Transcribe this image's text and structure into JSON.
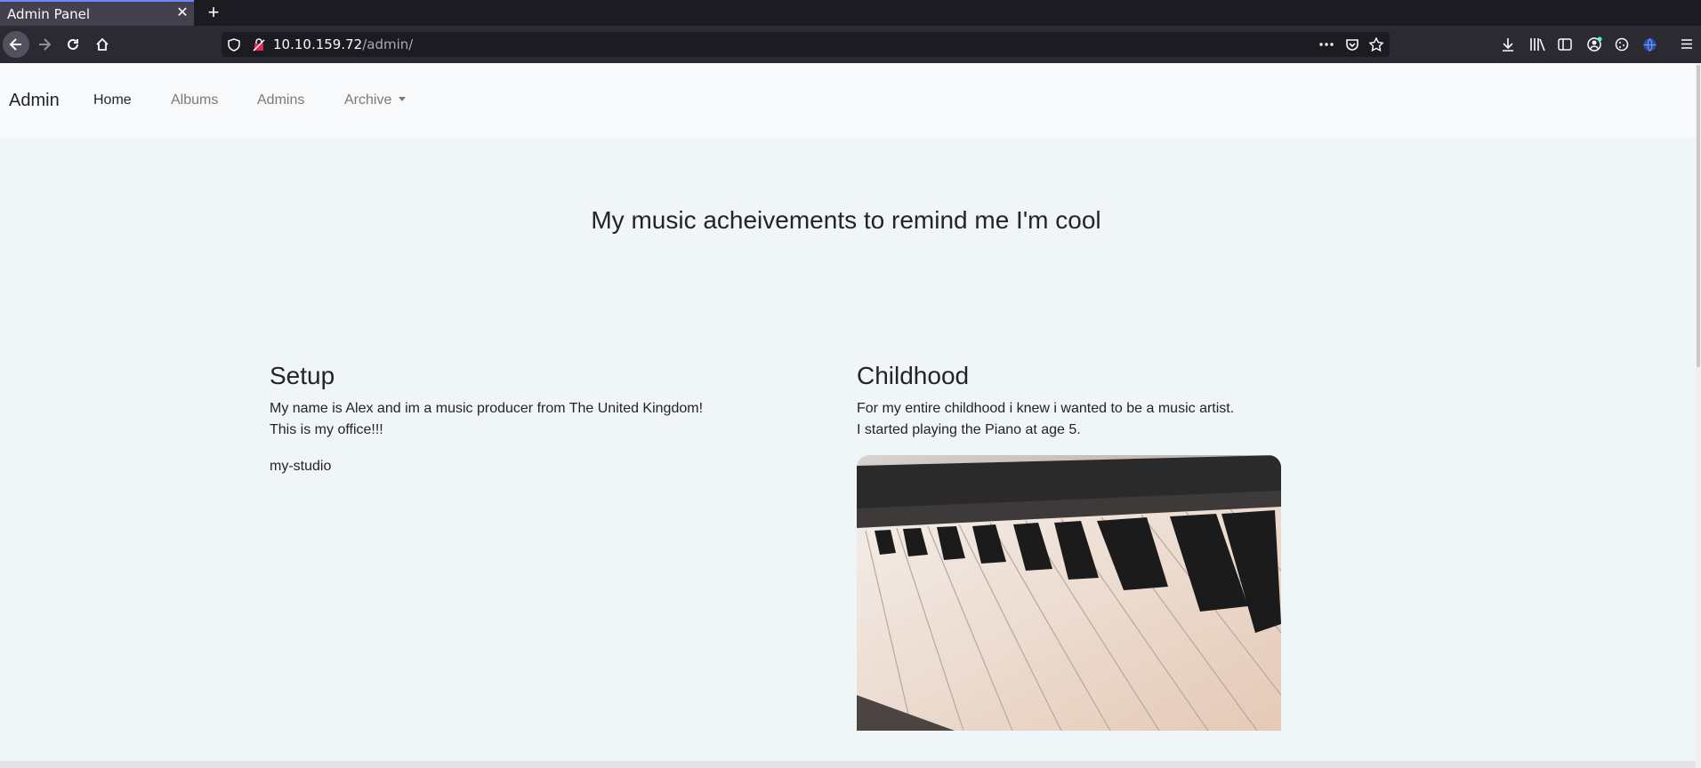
{
  "browser": {
    "tab_title": "Admin Panel",
    "url_host": "10.10.159.72",
    "url_path": "/admin/"
  },
  "site": {
    "brand": "Admin",
    "nav": [
      {
        "label": "Home"
      },
      {
        "label": "Albums"
      },
      {
        "label": "Admins"
      },
      {
        "label": "Archive"
      }
    ],
    "hero_title": "My music acheivements to remind me I'm cool",
    "setup": {
      "title": "Setup",
      "line1": "My name is Alex and im a music producer from The United Kingdom!",
      "line2": "This is my office!!!",
      "image_alt": "my-studio"
    },
    "childhood": {
      "title": "Childhood",
      "line1": "For my entire childhood i knew i wanted to be a music artist.",
      "line2": "I started playing the Piano at age 5."
    }
  }
}
